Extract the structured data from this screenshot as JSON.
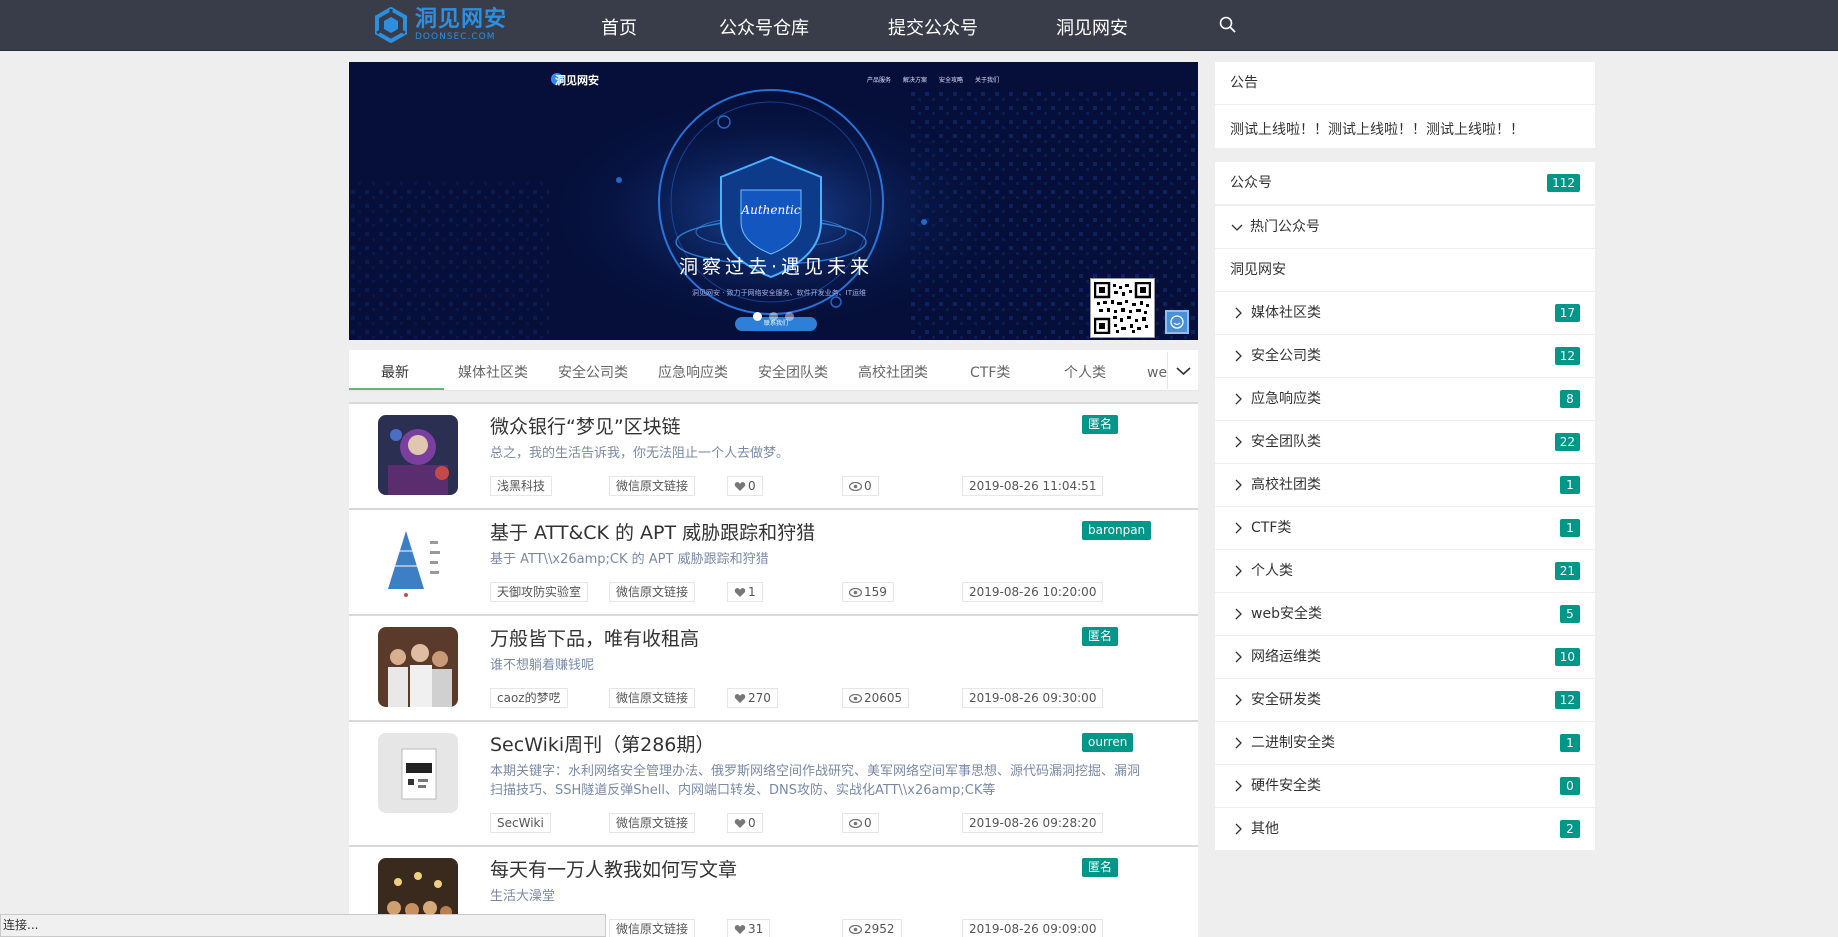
{
  "nav": {
    "logo_cn": "洞见网安",
    "logo_en": "DOONSEC.COM",
    "items": [
      "首页",
      "公众号仓库",
      "提交公众号",
      "洞见网安"
    ]
  },
  "banner": {
    "brand": "洞见网安",
    "menu": [
      "产品服务",
      "解决方案",
      "安全攻略",
      "关于我们"
    ],
    "shield_text": "Authentic",
    "slogan": "洞察过去·遇见未来",
    "sub": "洞见网安 · 致力于网络安全服务、软件开发业务、IT运维",
    "button": "联系我们"
  },
  "tabs": [
    "最新",
    "媒体社区类",
    "安全公司类",
    "应急响应类",
    "安全团队类",
    "高校社团类",
    "CTF类",
    "个人类",
    "web安全类"
  ],
  "articles": [
    {
      "title": "微众银行“梦见”区块链",
      "desc": "总之，我的生活告诉我，你无法阻止一个人去做梦。",
      "badge": "匿名",
      "source": "浅黑科技",
      "link": "微信原文链接",
      "likes": "0",
      "views": "0",
      "date": "2019-08-26 11:04:51"
    },
    {
      "title": "基于 ATT&CK 的 APT 威胁跟踪和狩猎",
      "desc": "基于 ATT\\\\x26amp;CK 的 APT 威胁跟踪和狩猎",
      "badge": "baronpan",
      "source": "天御攻防实验室",
      "link": "微信原文链接",
      "likes": "1",
      "views": "159",
      "date": "2019-08-26 10:20:00"
    },
    {
      "title": "万般皆下品，唯有收租高",
      "desc": "谁不想躺着赚钱呢",
      "badge": "匿名",
      "source": "caoz的梦呓",
      "link": "微信原文链接",
      "likes": "270",
      "views": "20605",
      "date": "2019-08-26 09:30:00"
    },
    {
      "title": "SecWiki周刊（第286期）",
      "desc": "本期关键字：水利网络安全管理办法、俄罗斯网络空间作战研究、美军网络空间军事思想、源代码漏洞挖掘、漏洞扫描技巧、SSH隧道反弹Shell、内网端口转发、DNS攻防、实战化ATT\\\\x26amp;CK等",
      "badge": "ourren",
      "source": "SecWiki",
      "link": "微信原文链接",
      "likes": "0",
      "views": "0",
      "date": "2019-08-26 09:28:20"
    },
    {
      "title": "每天有一万人教我如何写文章",
      "desc": "生活大澡堂",
      "badge": "匿名",
      "source": "",
      "link": "微信原文链接",
      "likes": "31",
      "views": "2952",
      "date": "2019-08-26 09:09:00"
    }
  ],
  "sidebar": {
    "notice_title": "公告",
    "notice_text": "测试上线啦！！测试上线啦！！测试上线啦！！",
    "accounts_title": "公众号",
    "accounts_count": "112",
    "hot_title": "热门公众号",
    "hot_item": "洞见网安",
    "categories": [
      {
        "label": "媒体社区类",
        "count": "17"
      },
      {
        "label": "安全公司类",
        "count": "12"
      },
      {
        "label": "应急响应类",
        "count": "8"
      },
      {
        "label": "安全团队类",
        "count": "22"
      },
      {
        "label": "高校社团类",
        "count": "1"
      },
      {
        "label": "CTF类",
        "count": "1"
      },
      {
        "label": "个人类",
        "count": "21"
      },
      {
        "label": "web安全类",
        "count": "5"
      },
      {
        "label": "网络运维类",
        "count": "10"
      },
      {
        "label": "安全研发类",
        "count": "12"
      },
      {
        "label": "二进制安全类",
        "count": "1"
      },
      {
        "label": "硬件安全类",
        "count": "0"
      },
      {
        "label": "其他",
        "count": "2"
      }
    ]
  },
  "status": {
    "text": "连接..."
  },
  "colors": {
    "topbar": "#393d49",
    "accent": "#009688",
    "logo": "#2d8fe0",
    "tab_active": "#5fb878"
  }
}
